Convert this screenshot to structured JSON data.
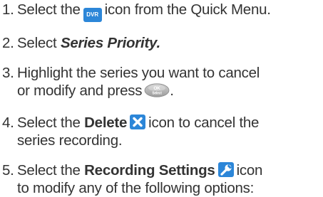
{
  "steps": [
    {
      "number": "1.",
      "text_before": "Select the",
      "icon_label": "DVR",
      "text_after": "icon from the Quick Menu."
    },
    {
      "number": "2.",
      "text_before": "Select",
      "emphasis": "Series Priority."
    },
    {
      "number": "3.",
      "line1": "Highlight the series you want to cancel",
      "line2_before": "or modify and press",
      "key_top": "OK",
      "key_bottom": "Select",
      "line2_after": "."
    },
    {
      "number": "4.",
      "text_before": "Select the",
      "emphasis": "Delete",
      "text_after": "icon to cancel the",
      "line2": "series recording."
    },
    {
      "number": "5.",
      "text_before": "Select the",
      "emphasis": "Recording Settings",
      "text_after": "icon",
      "line2": "to modify any of the following options:"
    }
  ],
  "colors": {
    "text": "#333333",
    "icon_blue": "#2c86d8",
    "key_gray": "#b5b5b5"
  },
  "icons": {
    "step1": "dvr-icon",
    "step3": "ok-select-key-icon",
    "step4": "delete-x-icon",
    "step5": "wrench-settings-icon"
  }
}
